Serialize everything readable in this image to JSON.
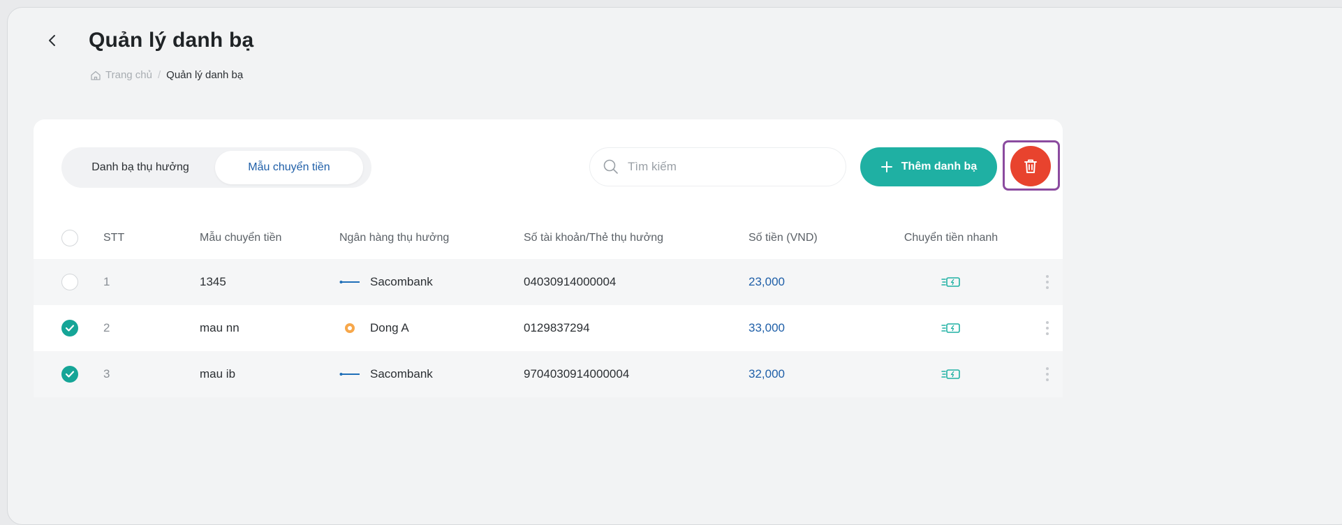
{
  "header": {
    "title": "Quản lý danh bạ",
    "breadcrumb": {
      "home": "Trang chủ",
      "separator": "/",
      "current": "Quản lý danh bạ"
    }
  },
  "tabs": [
    {
      "label": "Danh bạ thụ hưởng",
      "active": false
    },
    {
      "label": "Mẫu chuyển tiền",
      "active": true
    }
  ],
  "search": {
    "placeholder": "Tìm kiếm",
    "value": ""
  },
  "actions": {
    "add_label": "Thêm danh bạ",
    "delete_icon": "trash-icon"
  },
  "table": {
    "columns": [
      "STT",
      "Mẫu chuyển tiền",
      "Ngân hàng thụ hưởng",
      "Số tài khoản/Thẻ thụ hưởng",
      "Số tiền (VND)",
      "Chuyển tiền nhanh"
    ],
    "rows": [
      {
        "stt": "1",
        "name": "1345",
        "bank": "Sacombank",
        "account": "04030914000004",
        "amount": "23,000",
        "checked": false
      },
      {
        "stt": "2",
        "name": "mau nn",
        "bank": "Dong A",
        "account": "0129837294",
        "amount": "33,000",
        "checked": true
      },
      {
        "stt": "3",
        "name": "mau ib",
        "bank": "Sacombank",
        "account": "9704030914000004",
        "amount": "32,000",
        "checked": true
      }
    ]
  },
  "colors": {
    "accent_teal": "#1fb0a3",
    "danger_red": "#e8432e",
    "link_blue": "#1f5fa8",
    "highlight_purple": "#8b4b9f"
  }
}
